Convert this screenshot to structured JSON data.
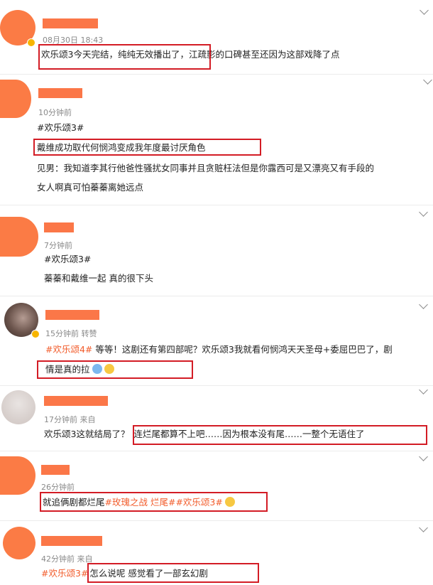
{
  "posts": [
    {
      "time": "08月30日 18:43",
      "line1_pre": "欢乐颂3今天完结，纯纯无效播出了，",
      "line1_post": "江疏影的口碑甚至还因为这部戏降了点"
    },
    {
      "time": "10分钟前",
      "tag": "#欢乐颂3#",
      "line1": "戴维成功取代何悯鸿变成我年度最讨厌角色",
      "line2": "见男：我知道李其行他爸性骚扰女同事并且贪赃枉法但是你露西可是又漂亮又有手段的",
      "line3": "女人啊真可怕蓁蓁离她远点"
    },
    {
      "time": "7分钟前",
      "tag": "#欢乐颂3#",
      "line1": "蓁蓁和戴维一起 真的很下头"
    },
    {
      "time": "15分钟前 转赞",
      "tag": "#欢乐颂4#",
      "line1_rest": " 等等！这剧还有第四部呢？欢乐颂3我就看何悯鸿天天圣母+委屈巴巴了，剧",
      "line2": "情是真的拉",
      "emoji": [
        "crying-face-icon",
        "laughing-tears-icon"
      ]
    },
    {
      "time": "17分钟前  来自",
      "line1_pre": "欢乐颂3这就结局了？",
      "line1_post": "连烂尾都算不上吧……因为根本没有尾……一整个无语住了"
    },
    {
      "time": "26分钟前",
      "line1_pre": "就追俩剧都烂尾",
      "tag1": "#玫瑰之战 烂尾#",
      "tag2": "#欢乐颂3#",
      "emoji": [
        "sweat-smile-icon"
      ]
    },
    {
      "time": "42分钟前  来自",
      "tag": "#欢乐颂3#",
      "line1": "怎么说呢 感觉看了一部玄幻剧"
    }
  ],
  "colors": {
    "highlight_box": "#d31c25",
    "topic_tag": "#f25c2b",
    "avatar_orange": "#fb7b45"
  }
}
